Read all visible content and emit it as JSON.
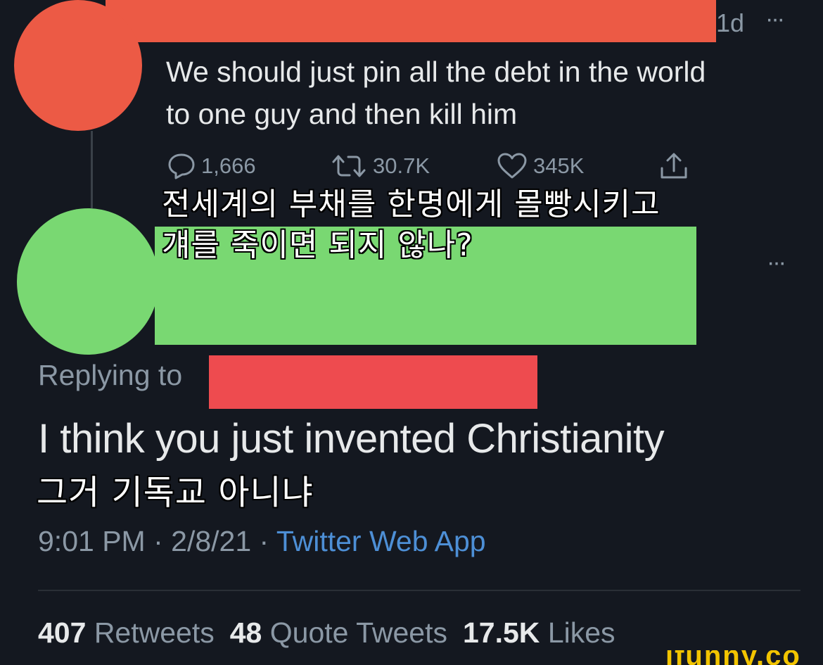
{
  "original_tweet": {
    "time": "1d",
    "more": "···",
    "text_line1": "We should just pin all the debt in the world",
    "text_line2": "to one guy and then kill him",
    "replies": "1,666",
    "retweets": "30.7K",
    "likes": "345K",
    "icons": [
      "reply-icon",
      "retweet-icon",
      "like-icon",
      "share-icon"
    ]
  },
  "subtitle1": {
    "line1": "전세계의 부채를 한명에게 몰빵시키고",
    "line2": "걔를 죽이면 되지 않나?"
  },
  "reply_tweet": {
    "more": "···",
    "replying_to_label": "Replying to",
    "text": "I think you just invented Christianity",
    "subtitle": "그거 기독교 아니냐",
    "time": "9:01 PM",
    "sep1": " · ",
    "date": "2/8/21",
    "sep2": " · ",
    "app": "Twitter Web App",
    "retweet_count": "407",
    "retweet_label": "Retweets",
    "quote_count": "48",
    "quote_label": "Quote Tweets",
    "like_count": "17.5K",
    "like_label": "Likes"
  },
  "watermark": "ifunny.co",
  "colors": {
    "background": "#141820",
    "redaction_red": "#ec5a45",
    "redaction_green": "#79d872",
    "link_blue": "#4d8fd6",
    "secondary_text": "#8b98a5"
  }
}
